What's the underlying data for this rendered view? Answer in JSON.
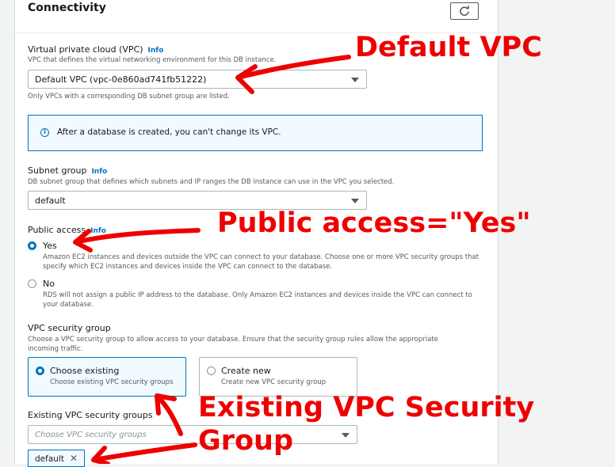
{
  "section": {
    "title": "Connectivity",
    "refresh_icon": "refresh-icon"
  },
  "vpc": {
    "label": "Virtual private cloud (VPC)",
    "info": "Info",
    "description": "VPC that defines the virtual networking environment for this DB instance.",
    "selected": "Default VPC (vpc-0e860ad741fb51222)",
    "helper": "Only VPCs with a corresponding DB subnet group are listed."
  },
  "alert": {
    "icon": "info-circle-icon",
    "text": "After a database is created, you can't change its VPC."
  },
  "subnet": {
    "label": "Subnet group",
    "info": "Info",
    "description": "DB subnet group that defines which subnets and IP ranges the DB instance can use in the VPC you selected.",
    "selected": "default"
  },
  "public_access": {
    "label": "Public access",
    "info": "Info",
    "yes_label": "Yes",
    "yes_desc": "Amazon EC2 instances and devices outside the VPC can connect to your database. Choose one or more VPC security groups that specify which EC2 instances and devices inside the VPC can connect to the database.",
    "no_label": "No",
    "no_desc": "RDS will not assign a public IP address to the database. Only Amazon EC2 instances and devices inside the VPC can connect to your database.",
    "selected": "Yes"
  },
  "security_group": {
    "label": "VPC security group",
    "description": "Choose a VPC security group to allow access to your database. Ensure that the security group rules allow the appropriate incoming traffic.",
    "options": [
      {
        "label": "Choose existing",
        "desc": "Choose existing VPC security groups",
        "selected": true
      },
      {
        "label": "Create new",
        "desc": "Create new VPC security group",
        "selected": false
      }
    ]
  },
  "existing_groups": {
    "label": "Existing VPC security groups",
    "placeholder": "Choose VPC security groups",
    "tokens": [
      "default"
    ]
  },
  "annotations": {
    "color": "#ee0000",
    "default_vpc": "Default VPC",
    "public_access": "Public access=\"Yes\"",
    "existing_sg_line1": "Existing VPC Security",
    "existing_sg_line2": "Group"
  }
}
